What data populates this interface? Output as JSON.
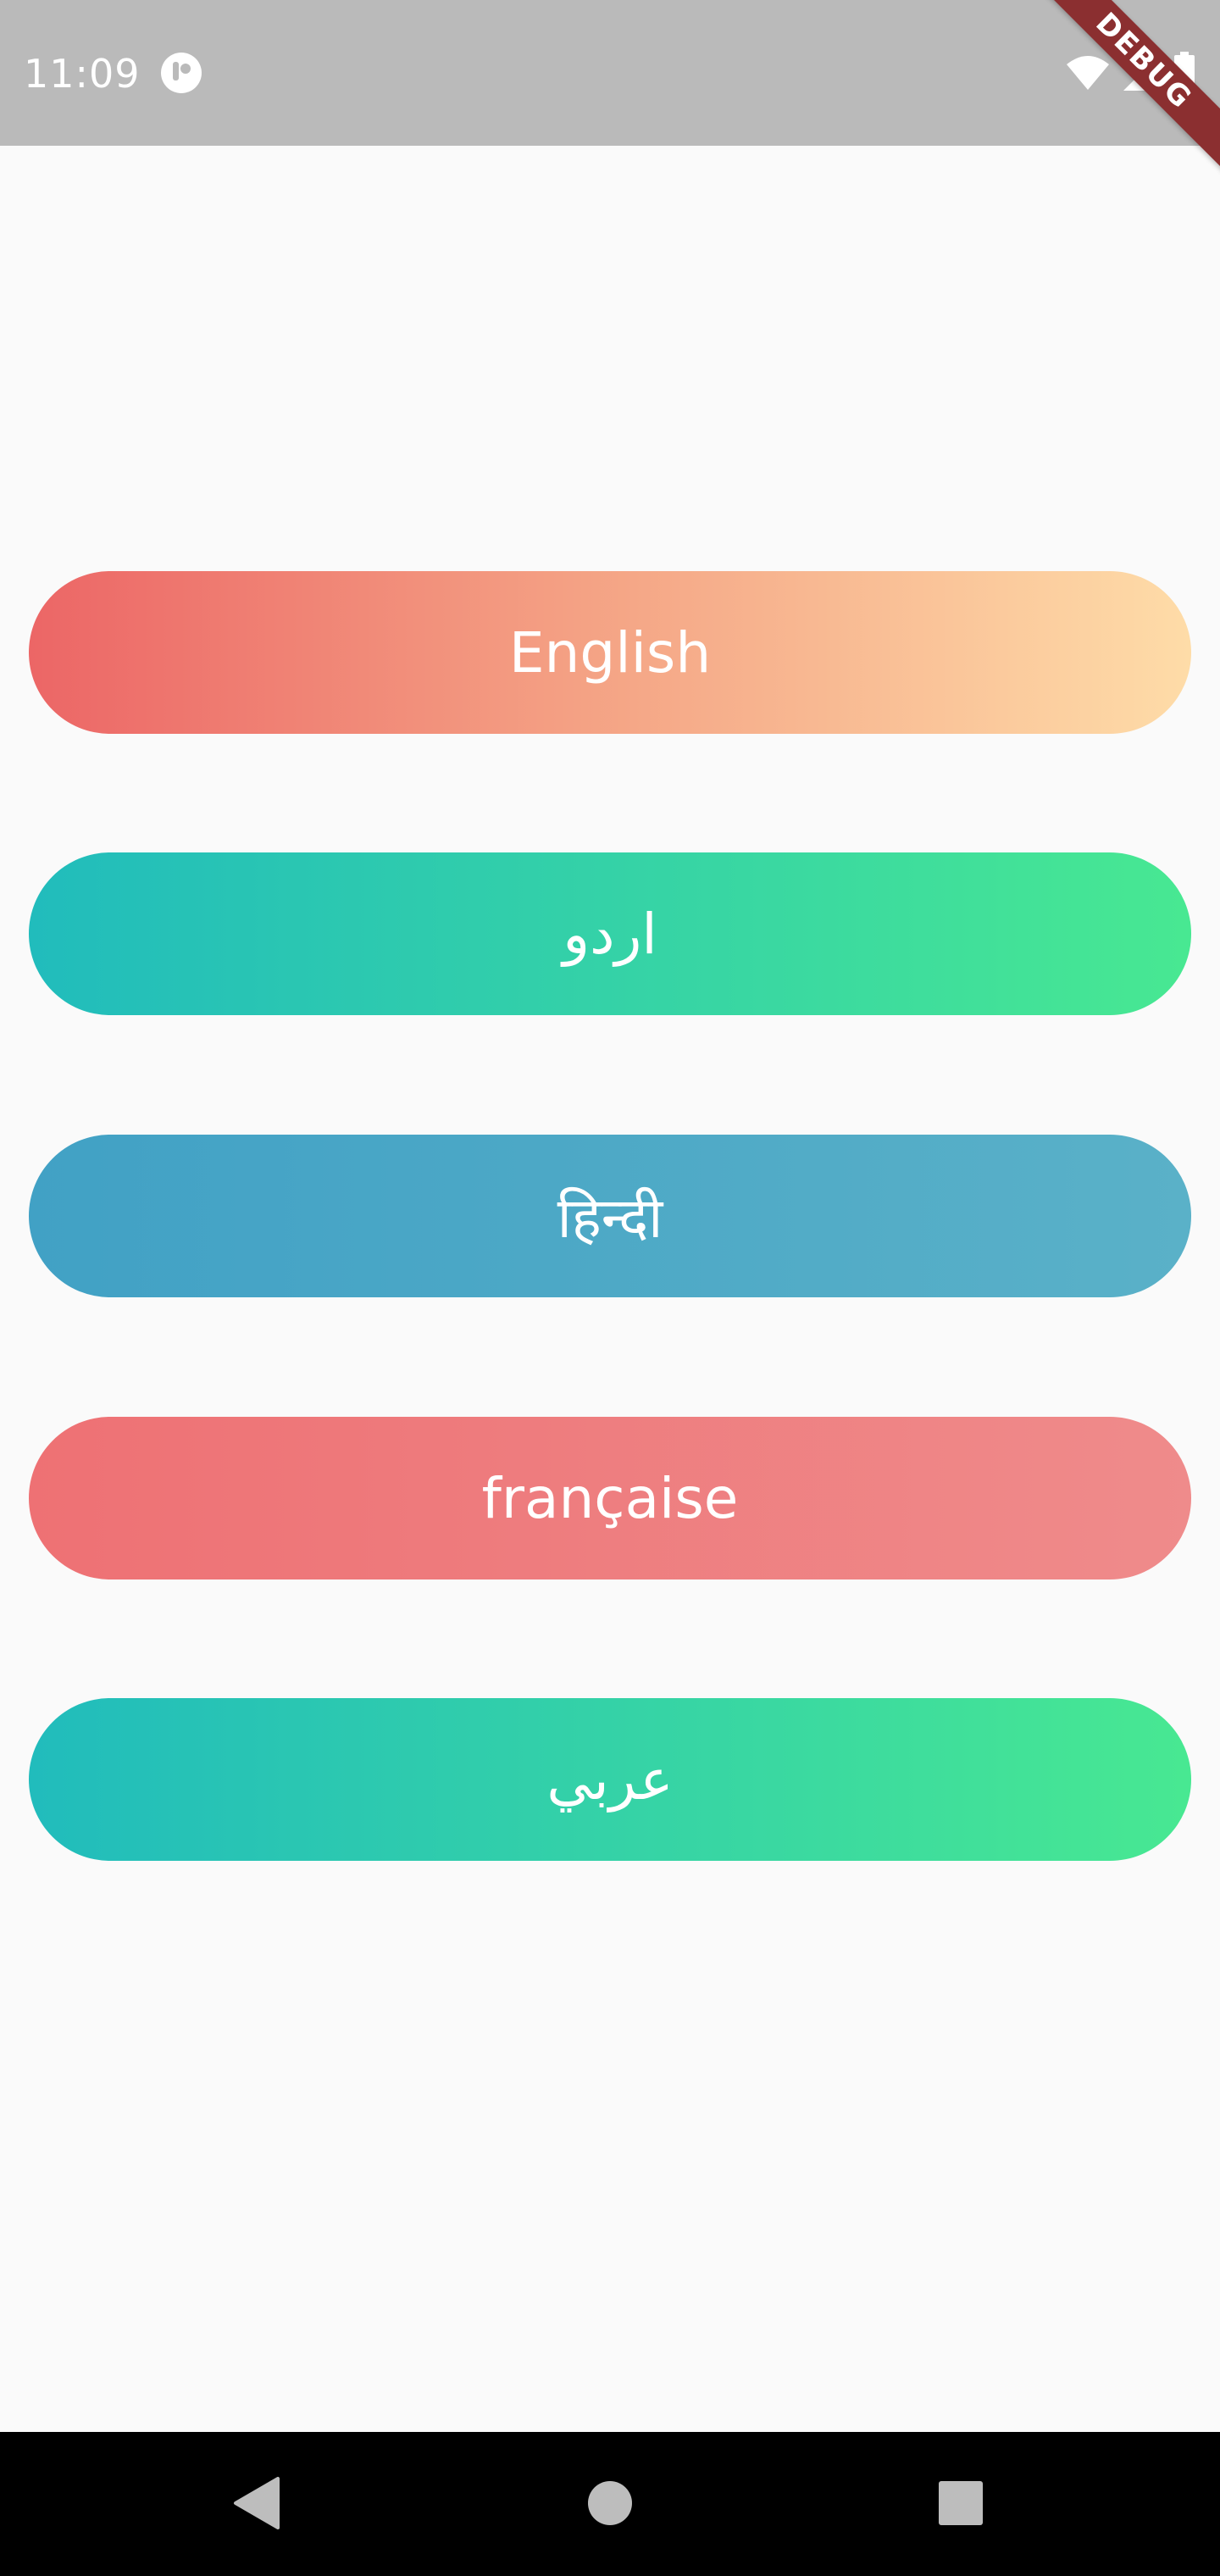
{
  "status_bar": {
    "time": "11:09",
    "icons": [
      "app-notification-icon",
      "wifi-icon",
      "cell-signal-icon",
      "battery-icon"
    ]
  },
  "debug_banner": {
    "label": "DEBUG"
  },
  "languages": [
    {
      "label": "English"
    },
    {
      "label": "اردو"
    },
    {
      "label": "हिन्दी"
    },
    {
      "label": "française"
    },
    {
      "label": "عربي"
    }
  ],
  "colors": {
    "english_gradient": [
      "#ec6666",
      "#fedca8"
    ],
    "urdu_gradient": [
      "#21bcbc",
      "#48e892"
    ],
    "hindi_gradient": [
      "#41a1c5",
      "#5ab1c8"
    ],
    "french_gradient": [
      "#ee7174",
      "#ef8b8b"
    ],
    "arabic_gradient": [
      "#21bcbc",
      "#48e892"
    ]
  },
  "nav_bar": {
    "icons": [
      "back-icon",
      "home-icon",
      "recents-icon"
    ]
  }
}
